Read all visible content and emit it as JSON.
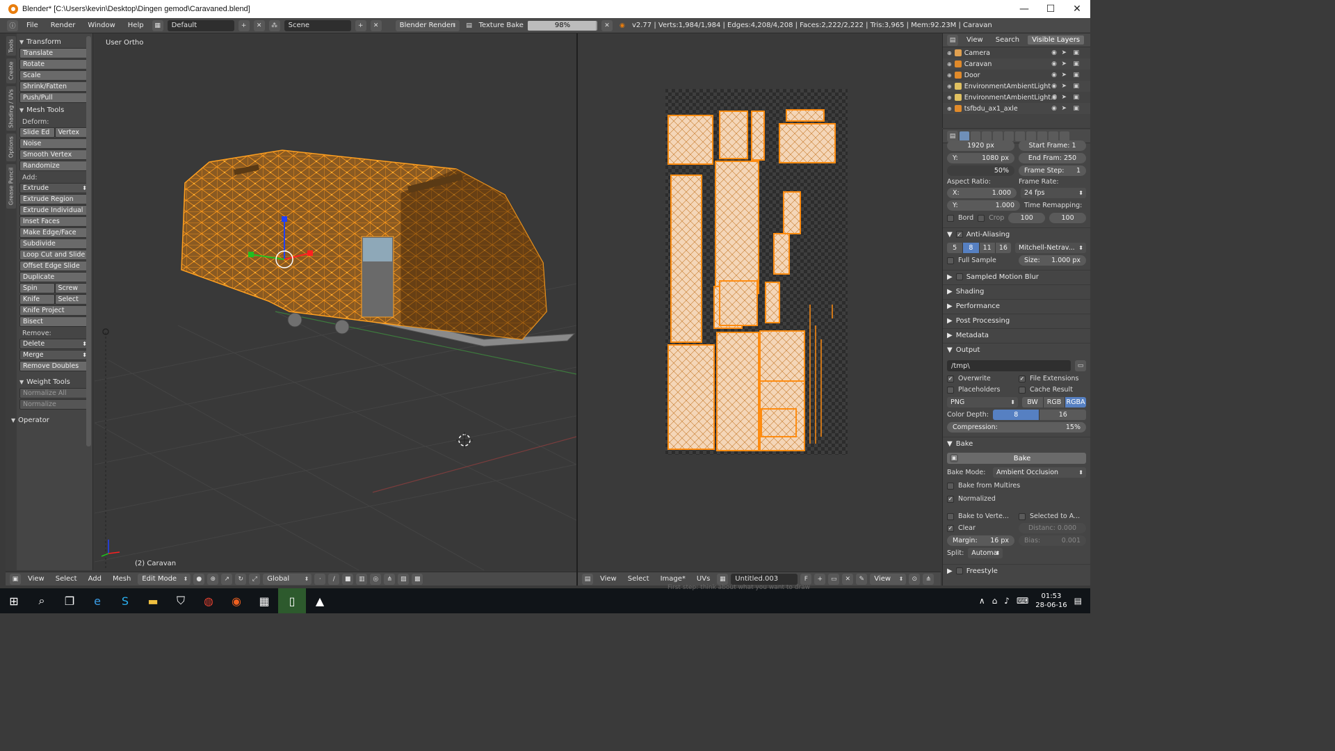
{
  "window": {
    "title": "Blender* [C:\\Users\\kevin\\Desktop\\Dingen gemod\\Caravaned.blend]",
    "min": "—",
    "max": "☐",
    "close": "✕"
  },
  "topbar": {
    "menus": [
      "File",
      "Render",
      "Window",
      "Help"
    ],
    "layout": "Default",
    "scene": "Scene",
    "engine": "Blender Render",
    "job_label": "Texture Bake",
    "progress": 0.98,
    "progress_text": "98%",
    "stats": "v2.77 | Verts:1,984/1,984 | Edges:4,208/4,208 | Faces:2,222/2,222 | Tris:3,965 | Mem:92.23M | Caravan"
  },
  "vtabs": [
    "Tools",
    "Create",
    "Shading / UVs",
    "Options",
    "Grease Pencil"
  ],
  "toolshelf": {
    "transform_title": "Transform",
    "transform": [
      "Translate",
      "Rotate",
      "Scale",
      "Shrink/Fatten",
      "Push/Pull"
    ],
    "mesh_title": "Mesh Tools",
    "deform_label": "Deform:",
    "slide_edge": "Slide Ed",
    "vertex": "Vertex",
    "noise": "Noise",
    "smooth_vertex": "Smooth Vertex",
    "randomize": "Randomize",
    "add_label": "Add:",
    "extrude": "Extrude",
    "add_items": [
      "Extrude Region",
      "Extrude Individual",
      "Inset Faces",
      "Make Edge/Face",
      "Subdivide",
      "Loop Cut and Slide",
      "Offset Edge Slide",
      "Duplicate"
    ],
    "spin": "Spin",
    "screw": "Screw",
    "knife": "Knife",
    "select": "Select",
    "knife_project": "Knife Project",
    "bisect": "Bisect",
    "remove_label": "Remove:",
    "delete": "Delete",
    "merge": "Merge",
    "remove_doubles": "Remove Doubles",
    "weight_title": "Weight Tools",
    "normalize_all": "Normalize All",
    "normalize": "Normalize",
    "operator_title": "Operator"
  },
  "viewport": {
    "view_name": "User Ortho",
    "object_info": "(2) Caravan",
    "header": {
      "menus": [
        "View",
        "Select",
        "Add",
        "Mesh"
      ],
      "mode": "Edit Mode",
      "orientation": "Global"
    }
  },
  "uv": {
    "header": {
      "menus": [
        "View",
        "Select",
        "Image*",
        "UVs"
      ],
      "image": "Untitled.003",
      "fake": "F",
      "view": "View"
    }
  },
  "outliner": {
    "tabs": [
      "View",
      "Search",
      "Visible Layers"
    ],
    "items": [
      {
        "name": "Camera",
        "color": "#e0a050"
      },
      {
        "name": "Caravan",
        "color": "#e08a2a"
      },
      {
        "name": "Door",
        "color": "#e08a2a"
      },
      {
        "name": "EnvironmentAmbientLight",
        "color": "#e0c060"
      },
      {
        "name": "EnvironmentAmbientLight.0",
        "color": "#e0c060"
      },
      {
        "name": "tsfbdu_ax1_axle",
        "color": "#e08a2a"
      }
    ]
  },
  "props": {
    "partial": "1920 px",
    "start_frame_partial": "Start Frame: 1",
    "res_y": "Y:",
    "res_y_val": "1080 px",
    "end_frame": "End Fram: 250",
    "percent": "50%",
    "frame_step": "Frame Step:",
    "frame_step_val": "1",
    "aspect_label": "Aspect Ratio:",
    "framerate_label": "Frame Rate:",
    "ax": "X:",
    "ax_val": "1.000",
    "fps": "24 fps",
    "ay": "Y:",
    "ay_val": "1.000",
    "remap_label": "Time Remapping:",
    "bord": "Bord",
    "crop": "Crop",
    "remap_old": "100",
    "remap_new": "100",
    "aa_title": "Anti-Aliasing",
    "aa_samples": [
      "5",
      "8",
      "11",
      "16"
    ],
    "aa_filter": "Mitchell-Netrav...",
    "full_sample": "Full Sample",
    "size": "Size:",
    "size_val": "1.000 px",
    "sections": [
      "Sampled Motion Blur",
      "Shading",
      "Performance",
      "Post Processing",
      "Metadata"
    ],
    "output_title": "Output",
    "output_path": "/tmp\\",
    "overwrite": "Overwrite",
    "file_ext": "File Extensions",
    "placeholders": "Placeholders",
    "cache_result": "Cache Result",
    "format": "PNG",
    "color_modes": [
      "BW",
      "RGB",
      "RGBA"
    ],
    "color_depth": "Color Depth:",
    "depths": [
      "8",
      "16"
    ],
    "compression": "Compression:",
    "compression_val": "15%",
    "bake_title": "Bake",
    "bake_button": "Bake",
    "bake_mode_label": "Bake Mode:",
    "bake_mode": "Ambient Occlusion",
    "bake_multires": "Bake from Multires",
    "normalized": "Normalized",
    "bake_vertex": "Bake to Verte...",
    "selected_to": "Selected to A...",
    "clear": "Clear",
    "distance": "Distanc: 0.000",
    "margin": "Margin:",
    "margin_val": "16 px",
    "bias": "Bias:",
    "bias_val": "0.001",
    "split": "Split:",
    "split_val": "Automa",
    "freestyle": "Freestyle"
  },
  "taskbar": {
    "time": "01:53",
    "date": "28-06-16",
    "behind_text": "First step: think about what you want to draw"
  }
}
